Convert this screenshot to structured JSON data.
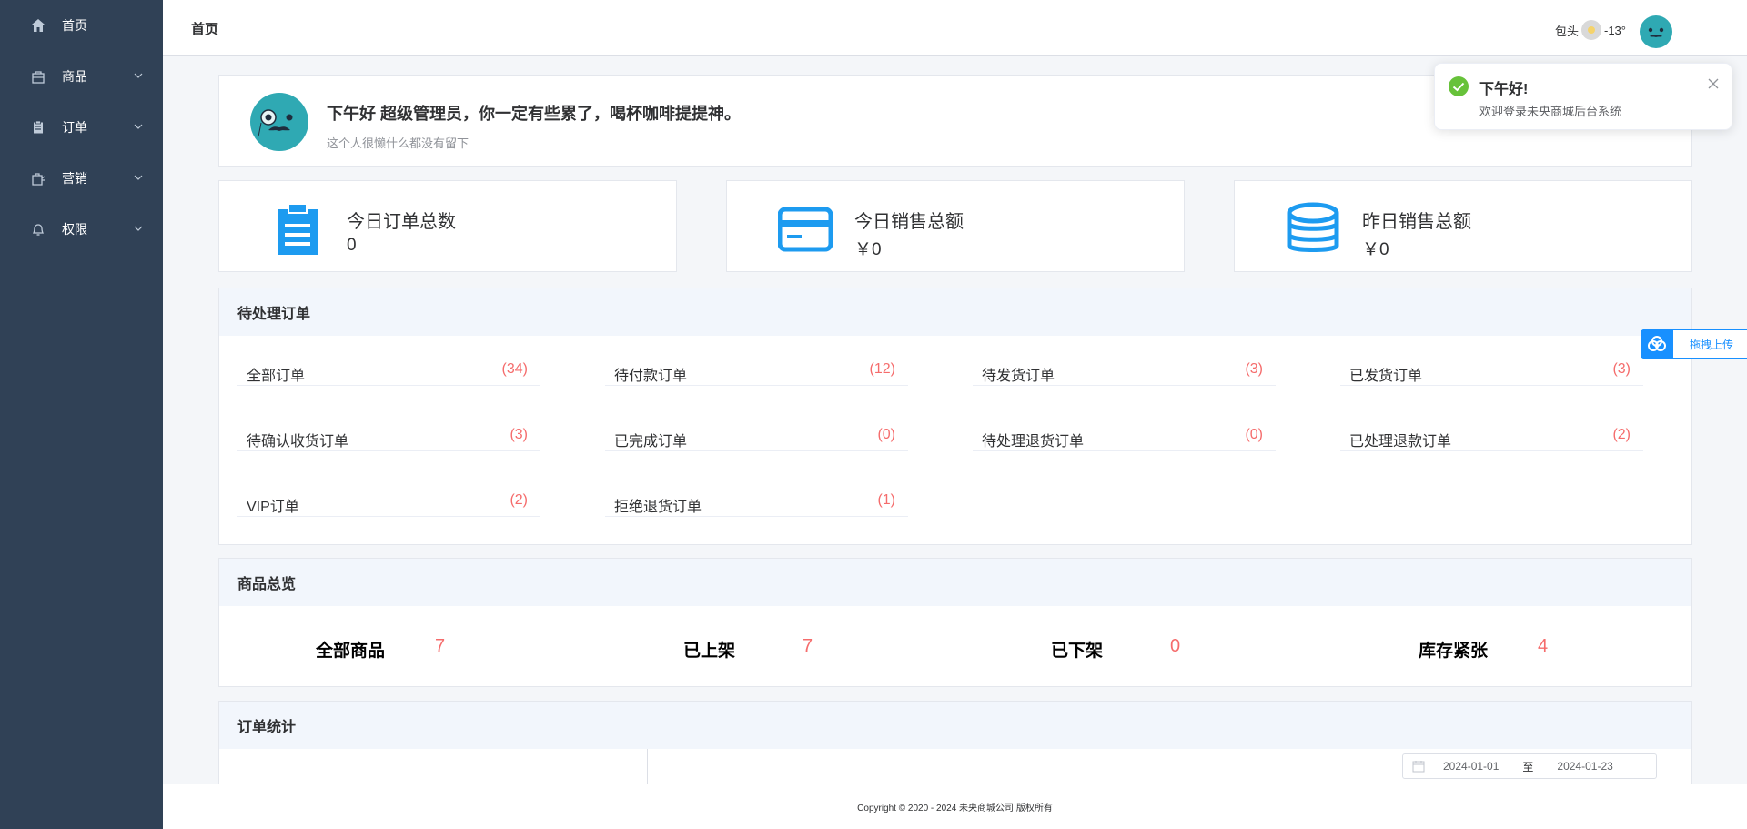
{
  "sidebar": {
    "items": [
      {
        "label": "首页",
        "icon": "home-icon",
        "has_children": false
      },
      {
        "label": "商品",
        "icon": "bag-icon",
        "has_children": true
      },
      {
        "label": "订单",
        "icon": "clipboard-icon",
        "has_children": true
      },
      {
        "label": "营销",
        "icon": "gift-icon",
        "has_children": true
      },
      {
        "label": "权限",
        "icon": "bell-icon",
        "has_children": true
      }
    ]
  },
  "header": {
    "breadcrumb": "首页",
    "city": "包头",
    "temperature": "-13°"
  },
  "welcome": {
    "greeting": "下午好 超级管理员，你一定有些累了，喝杯咖啡提提神。",
    "subtitle": "这个人很懒什么都没有留下"
  },
  "stats": [
    {
      "title": "今日订单总数",
      "value": "0",
      "icon": "clipboard-icon"
    },
    {
      "title": "今日销售总额",
      "value": "￥0",
      "icon": "credit-card-icon"
    },
    {
      "title": "昨日销售总额",
      "value": "￥0",
      "icon": "database-icon"
    }
  ],
  "pending": {
    "title": "待处理订单",
    "items": [
      {
        "label": "全部订单",
        "count": "(34)"
      },
      {
        "label": "待付款订单",
        "count": "(12)"
      },
      {
        "label": "待发货订单",
        "count": "(3)"
      },
      {
        "label": "已发货订单",
        "count": "(3)"
      },
      {
        "label": "待确认收货订单",
        "count": "(3)"
      },
      {
        "label": "已完成订单",
        "count": "(0)"
      },
      {
        "label": "待处理退货订单",
        "count": "(0)"
      },
      {
        "label": "已处理退款订单",
        "count": "(2)"
      },
      {
        "label": "VIP订单",
        "count": "(2)"
      },
      {
        "label": "拒绝退货订单",
        "count": "(1)"
      }
    ]
  },
  "goods": {
    "title": "商品总览",
    "items": [
      {
        "label": "全部商品",
        "value": "7"
      },
      {
        "label": "已上架",
        "value": "7"
      },
      {
        "label": "已下架",
        "value": "0"
      },
      {
        "label": "库存紧张",
        "value": "4"
      }
    ]
  },
  "order_stats": {
    "title": "订单统计",
    "date_start": "2024-01-01",
    "date_sep": "至",
    "date_end": "2024-01-23"
  },
  "footer": {
    "copyright": "Copyright © 2020 - 2024  未央商城公司 版权所有"
  },
  "notification": {
    "title": "下午好!",
    "message": "欢迎登录未央商城后台系统"
  },
  "upload": {
    "label": "拖拽上传"
  },
  "colors": {
    "sidebar_bg": "#304156",
    "accent": "#1890ff",
    "count_red": "#f56c6c",
    "success": "#67c23a"
  }
}
